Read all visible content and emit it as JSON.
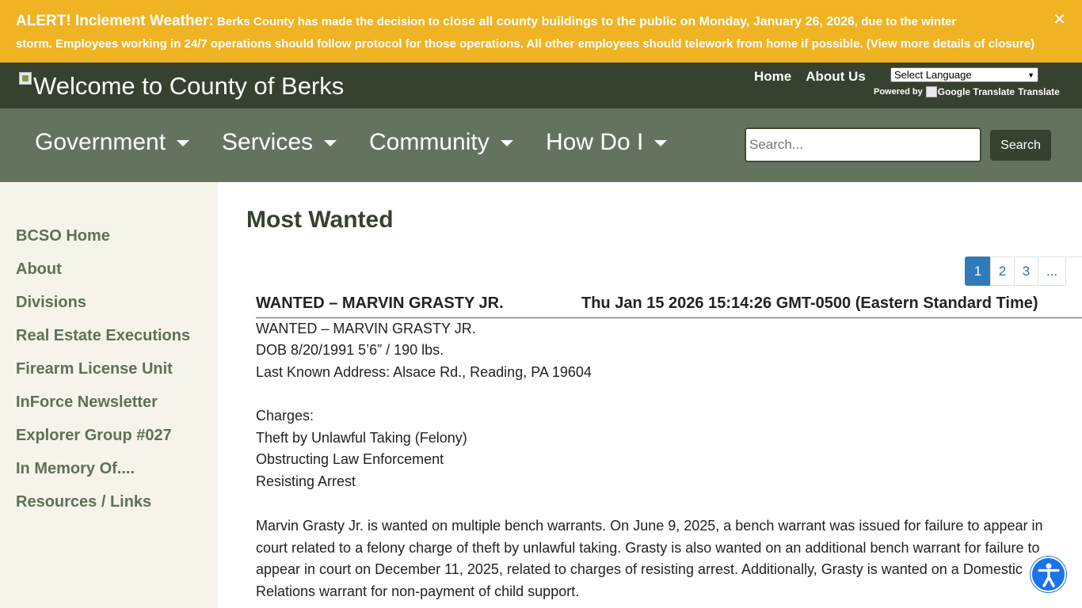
{
  "alert": {
    "title": "ALERT! Inclement Weather:",
    "line1_pre": " Berks County has made the decision to ",
    "line1_strong": "close all county buildings to the public on Monday, January 26, 2026",
    "line1_post": ", due to the winter",
    "line2": "storm. Employees working in 24/7 operations should follow protocol for those operations. All other employees should telework from home if possible. (View more details of closure)",
    "close_symbol": "✕"
  },
  "header": {
    "logo_alt": "Welcome to County of Berks",
    "links": [
      "Home",
      "About Us"
    ],
    "language_select": "Select Language",
    "powered_by": "Powered by",
    "google_translate_alt": "Google Translate",
    "translate_link": "Translate"
  },
  "nav": {
    "items": [
      "Government",
      "Services",
      "Community",
      "How Do I"
    ],
    "search_placeholder": "Search...",
    "search_button": "Search"
  },
  "sidebar": {
    "items": [
      "BCSO Home",
      "About",
      "Divisions",
      "Real Estate Executions",
      "Firearm License Unit",
      "InForce Newsletter",
      "Explorer Group #027",
      "In Memory Of....",
      "Resources / Links"
    ]
  },
  "main": {
    "title": "Most Wanted",
    "pages": [
      "1",
      "2",
      "3",
      "..."
    ],
    "post": {
      "title": "WANTED – MARVIN GRASTY JR.",
      "date": "Thu Jan 15 2026 15:14:26 GMT-0500 (Eastern Standard Time)",
      "lines": [
        "WANTED – MARVIN GRASTY JR.",
        "DOB 8/20/1991 5’6” / 190 lbs.",
        "Last Known Address: Alsace Rd., Reading, PA 19604",
        "Charges:",
        "Theft by Unlawful Taking (Felony)",
        "Obstructing Law Enforcement",
        "Resisting Arrest"
      ],
      "paragraph": "Marvin Grasty Jr. is wanted on multiple bench warrants. On June 9, 2025, a bench warrant was issued for failure to appear in court related to a felony charge of theft by unlawful taking. Grasty is also wanted on an additional bench warrant for failure to appear in court on December 11, 2025, related to charges of resisting arrest. Additionally, Grasty is wanted on a Domestic Relations warrant for non-payment of child support."
    }
  },
  "colors": {
    "alert_bg": "#f0b323",
    "header_bg": "#36412f",
    "nav_bg": "#64735e",
    "sidebar_bg": "#f6f4ea",
    "sidebar_link": "#5f7057",
    "pager_active": "#2f7ab7",
    "accessibility_button": "#1a73e8"
  },
  "icons": {
    "accessibility": "accessibility-icon",
    "dropdown": "caret-down-icon",
    "close": "close-icon"
  }
}
